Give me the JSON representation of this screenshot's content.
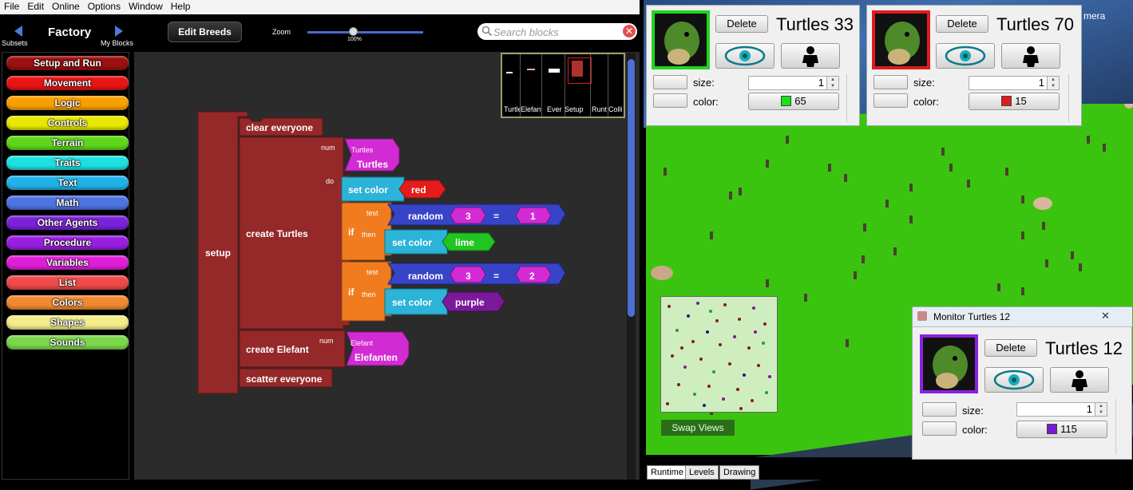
{
  "menu": [
    "File",
    "Edit",
    "Online",
    "Options",
    "Window",
    "Help"
  ],
  "toolbar": {
    "subsets_label": "Subsets",
    "title": "Factory",
    "myblocks_label": "My Blocks",
    "edit_breeds": "Edit Breeds",
    "zoom_label": "Zoom",
    "zoom_value": "100%",
    "search_placeholder": "Search blocks"
  },
  "palette": [
    {
      "label": "Setup and Run",
      "color": "#9b1010"
    },
    {
      "label": "Movement",
      "color": "#e81515"
    },
    {
      "label": "Logic",
      "color": "#f7a000"
    },
    {
      "label": "Controls",
      "color": "#e8e800"
    },
    {
      "label": "Terrain",
      "color": "#5fd61a"
    },
    {
      "label": "Traits",
      "color": "#1fe0e0"
    },
    {
      "label": "Text",
      "color": "#20b2e8"
    },
    {
      "label": "Math",
      "color": "#4d74e0"
    },
    {
      "label": "Other Agents",
      "color": "#7b22d8"
    },
    {
      "label": "Procedure",
      "color": "#9a1ee0"
    },
    {
      "label": "Variables",
      "color": "#e01ed8"
    },
    {
      "label": "List",
      "color": "#ee4a4a"
    },
    {
      "label": "Colors",
      "color": "#f08a30"
    },
    {
      "label": "Shapes",
      "color": "#f2ec8a"
    },
    {
      "label": "Sounds",
      "color": "#7bd64a"
    }
  ],
  "minimap": {
    "labels": [
      "Turtle",
      "Elefant",
      "Ever",
      "Setup",
      "Runt",
      "Colli"
    ]
  },
  "blocks": {
    "setup": "setup",
    "clear_everyone": "clear everyone",
    "create_turtles": "create Turtles",
    "num": "num",
    "do": "do",
    "turtles_small": "Turtles",
    "turtles": "Turtles",
    "set_color": "set color",
    "red": "red",
    "test": "test",
    "if": "if",
    "then": "then",
    "random": "random",
    "three": "3",
    "eq": "=",
    "one": "1",
    "two": "2",
    "lime": "lime",
    "purple": "purple",
    "create_elefant": "create Elefant",
    "elefant_small": "Elefant",
    "elefanten": "Elefanten",
    "scatter_everyone": "scatter everyone"
  },
  "monitors": [
    {
      "title": "Turtles 33",
      "delete": "Delete",
      "border_color": "#1fd61f",
      "size_label": "size:",
      "size_value": "1",
      "color_label": "color:",
      "color_value": "65",
      "swatch": "#19e019"
    },
    {
      "title": "Turtles 70",
      "delete": "Delete",
      "border_color": "#e01b1b",
      "size_label": "size:",
      "size_value": "1",
      "color_label": "color:",
      "color_value": "15",
      "swatch": "#e01b1b"
    },
    {
      "window_title": "Monitor Turtles 12",
      "close": "✕",
      "title": "Turtles 12",
      "delete": "Delete",
      "border_color": "#8a22e0",
      "size_label": "size:",
      "size_value": "1",
      "color_label": "color:",
      "color_value": "115",
      "swatch": "#7a18d8"
    }
  ],
  "world": {
    "camera_label": "mera",
    "swap_views": "Swap Views",
    "tabs": [
      "Runtime",
      "Levels",
      "Drawing"
    ]
  }
}
